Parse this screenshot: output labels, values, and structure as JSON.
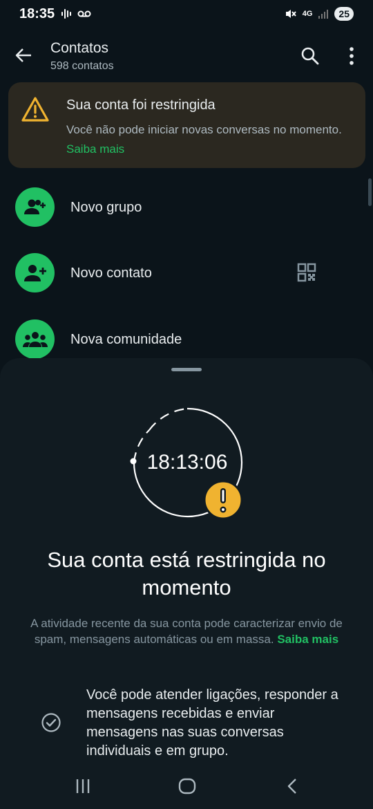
{
  "status_bar": {
    "time": "18:35",
    "network": "4G",
    "battery": "25"
  },
  "app_bar": {
    "title": "Contatos",
    "subtitle": "598 contatos"
  },
  "banner": {
    "title": "Sua conta foi restringida",
    "text": "Você não pode iniciar novas conversas no momento.",
    "link": "Saiba mais",
    "accent": "#f0b330"
  },
  "rows": [
    {
      "label": "Novo grupo",
      "icon": "group-add-icon"
    },
    {
      "label": "Novo contato",
      "icon": "person-add-icon"
    },
    {
      "label": "Nova comunidade",
      "icon": "community-icon"
    }
  ],
  "sheet": {
    "timer": "18:13:06",
    "title": "Sua conta está restringida no momento",
    "description": "A atividade recente da sua conta pode caracterizar envio de spam, mensagens automáticas ou em massa.",
    "link": "Saiba mais",
    "info": "Você pode atender ligações, responder a mensagens recebidas e enviar mensagens nas suas conversas individuais e em grupo."
  },
  "colors": {
    "background": "#0b141a",
    "brand_green": "#21c063",
    "warning_yellow": "#f0b330"
  }
}
